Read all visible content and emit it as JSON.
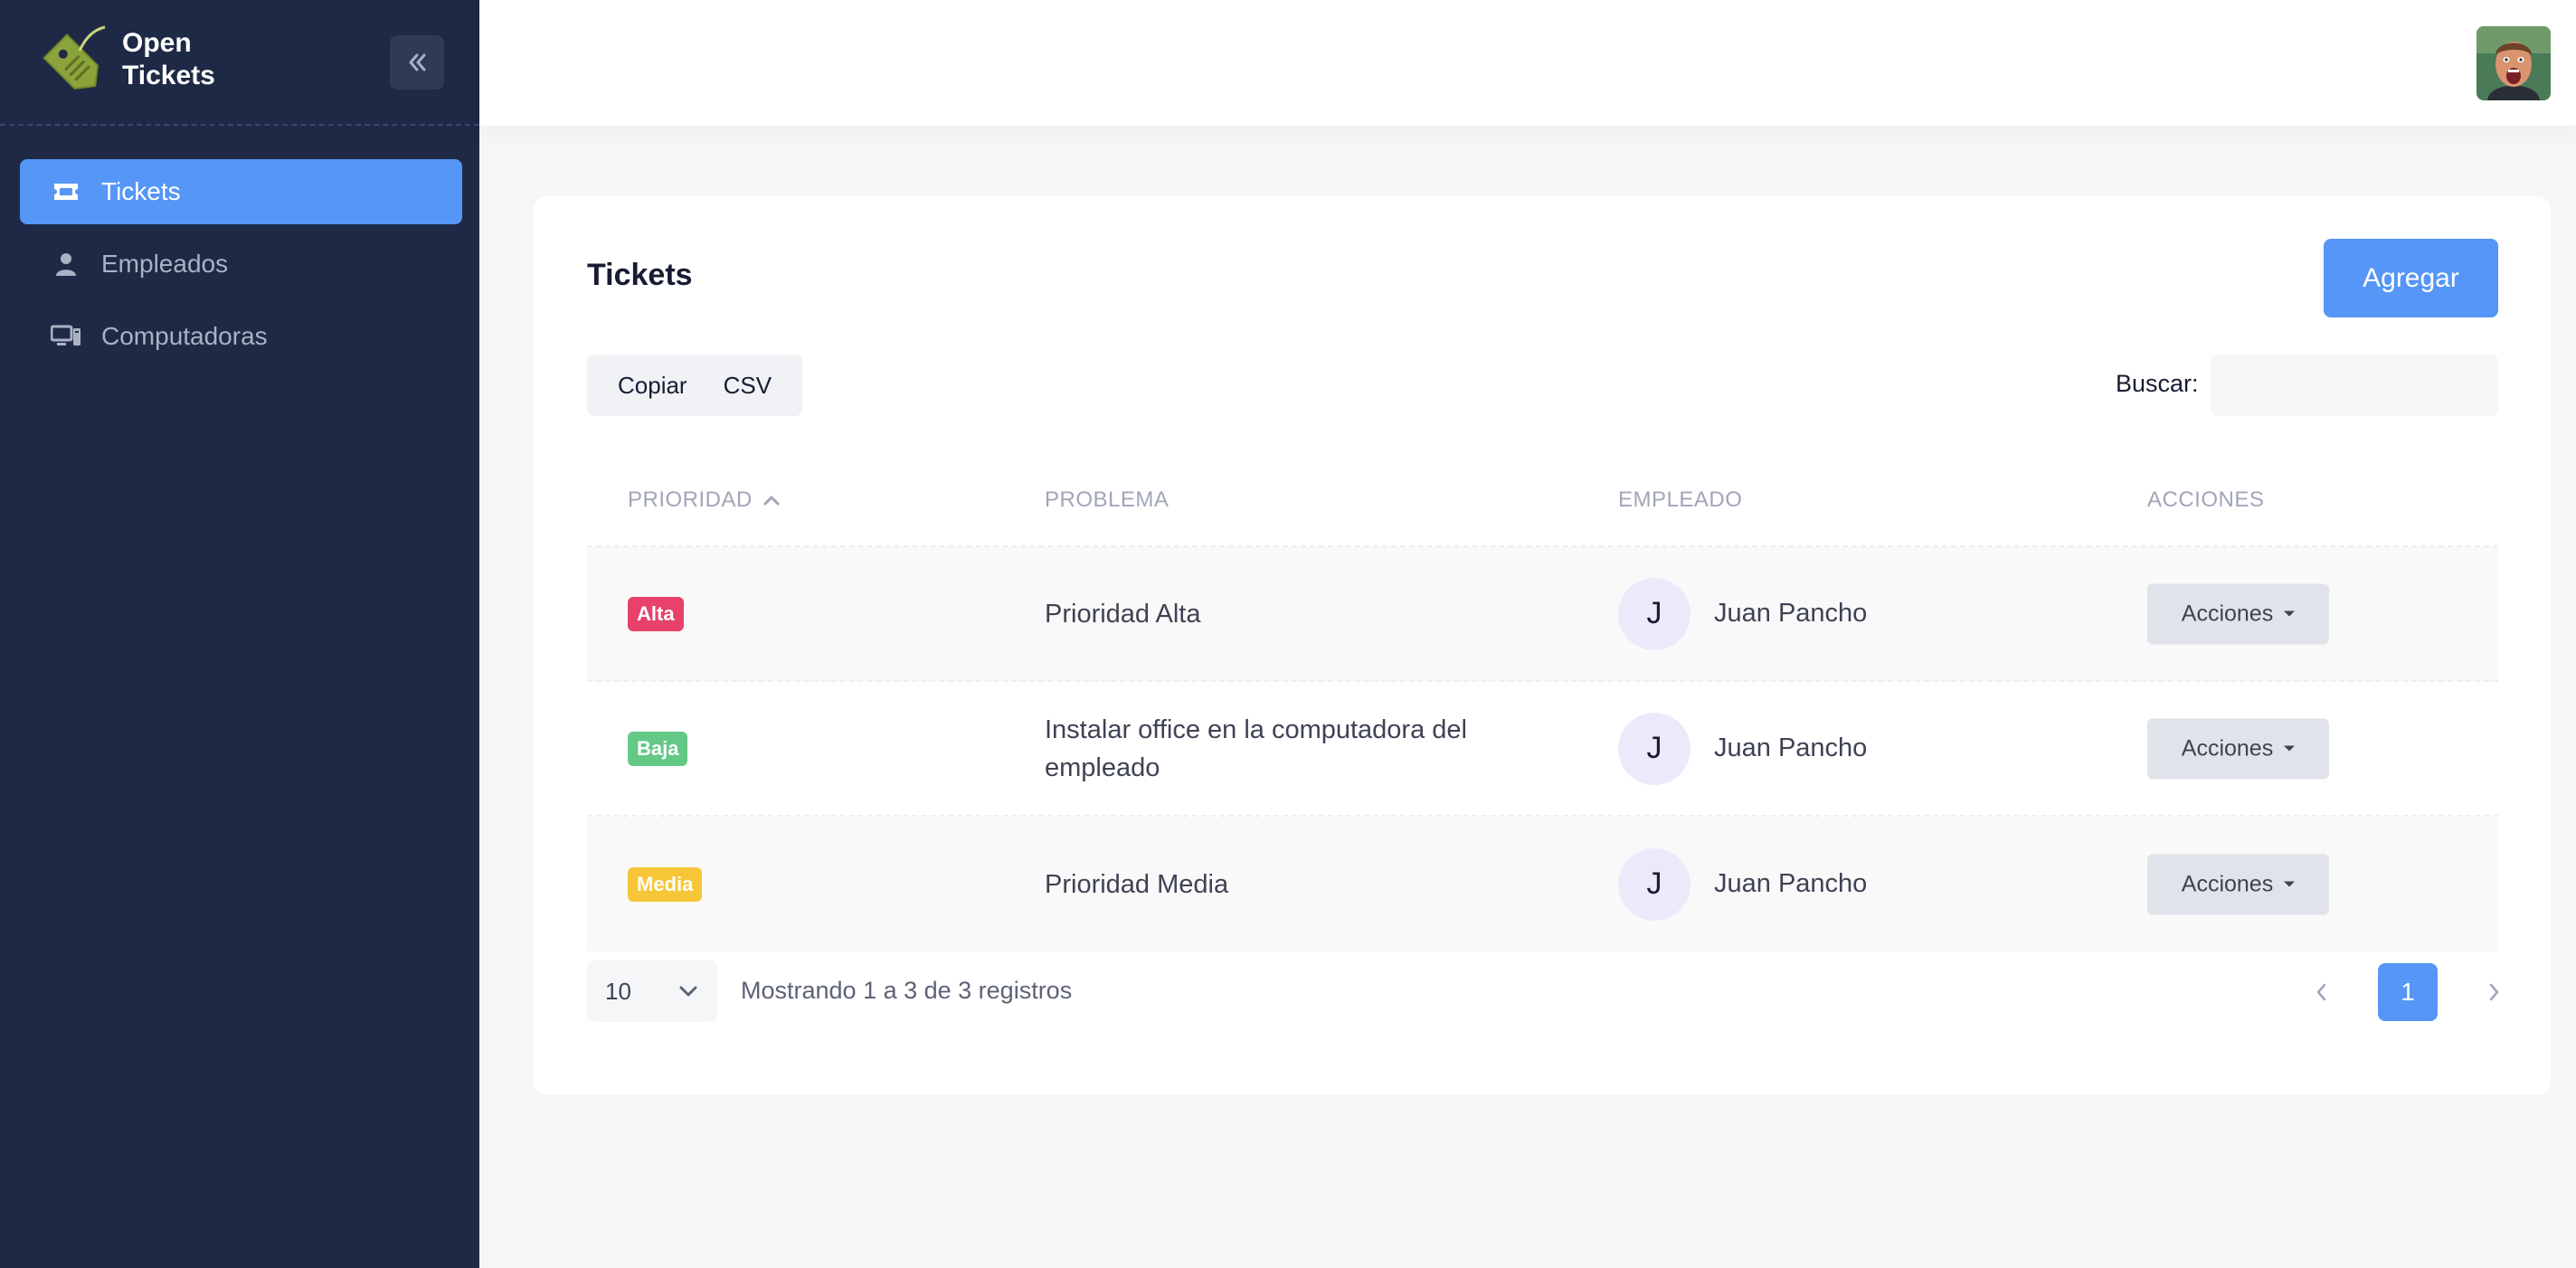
{
  "app": {
    "name_line1": "Open",
    "name_line2": "Tickets"
  },
  "sidebar": {
    "items": [
      {
        "label": "Tickets",
        "icon": "ticket-icon",
        "active": true
      },
      {
        "label": "Empleados",
        "icon": "person-icon",
        "active": false
      },
      {
        "label": "Computadoras",
        "icon": "computer-icon",
        "active": false
      }
    ]
  },
  "page": {
    "title": "Tickets",
    "add_label": "Agregar",
    "export": {
      "copy_label": "Copiar",
      "csv_label": "CSV"
    },
    "search": {
      "label": "Buscar:",
      "value": "",
      "placeholder": ""
    }
  },
  "table": {
    "columns": [
      "PRIORIDAD",
      "PROBLEMA",
      "EMPLEADO",
      "ACCIONES"
    ],
    "sort": {
      "column": "PRIORIDAD",
      "direction": "asc"
    },
    "rows": [
      {
        "priority": "Alta",
        "priority_color": "#e8416a",
        "problem": "Prioridad Alta",
        "employee_initial": "J",
        "employee": "Juan Pancho",
        "actions": "Acciones"
      },
      {
        "priority": "Baja",
        "priority_color": "#64c886",
        "problem": "Instalar office en la computadora del empleado",
        "employee_initial": "J",
        "employee": "Juan Pancho",
        "actions": "Acciones"
      },
      {
        "priority": "Media",
        "priority_color": "#f7c638",
        "problem": "Prioridad Media",
        "employee_initial": "J",
        "employee": "Juan Pancho",
        "actions": "Acciones"
      }
    ]
  },
  "footer": {
    "page_length": "10",
    "info": "Mostrando 1 a 3 de 3 registros",
    "current_page": "1"
  },
  "colors": {
    "sidebar_bg": "#1e2a45",
    "primary": "#5596f6",
    "content_bg": "#f5f6f8"
  }
}
